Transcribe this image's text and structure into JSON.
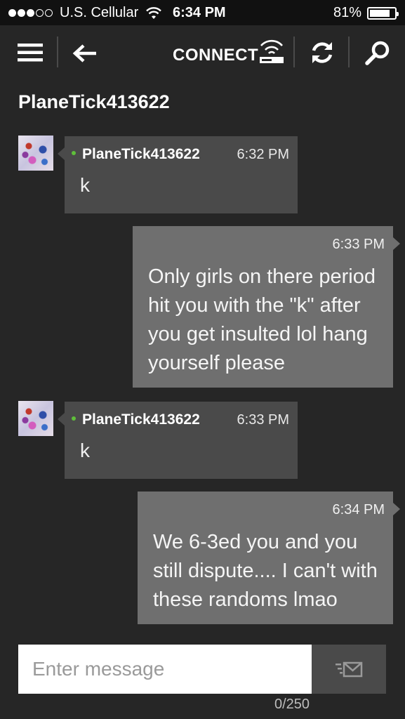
{
  "status_bar": {
    "carrier": "U.S. Cellular",
    "time": "6:34 PM",
    "battery": "81%",
    "battery_level": 0.81,
    "signal_bars_filled": 3,
    "signal_bars_total": 5
  },
  "app_bar": {
    "connect_label": "CONNECT",
    "icons": [
      "menu-icon",
      "back-arrow-icon",
      "console-wifi-icon",
      "refresh-icon",
      "search-icon"
    ]
  },
  "conversation": {
    "title": "PlaneTick413622",
    "messages": [
      {
        "direction": "incoming",
        "sender": "PlaneTick413622",
        "time": "6:32 PM",
        "text": "k"
      },
      {
        "direction": "outgoing",
        "time": "6:33 PM",
        "text": "Only girls on there period hit you with the \"k\" after you get insulted lol hang yourself please"
      },
      {
        "direction": "incoming",
        "sender": "PlaneTick413622",
        "time": "6:33 PM",
        "text": "k"
      },
      {
        "direction": "outgoing",
        "time": "6:34 PM",
        "text": "We 6-3ed you and you still dispute.... I can't with these randoms lmao"
      }
    ]
  },
  "composer": {
    "placeholder": "Enter message",
    "counter": "0/250"
  },
  "colors": {
    "background": "#262626",
    "status_bar": "#111111",
    "incoming_bubble": "#4a4a4a",
    "outgoing_bubble": "#6f6f6f",
    "online_dot": "#5fbf3a"
  }
}
